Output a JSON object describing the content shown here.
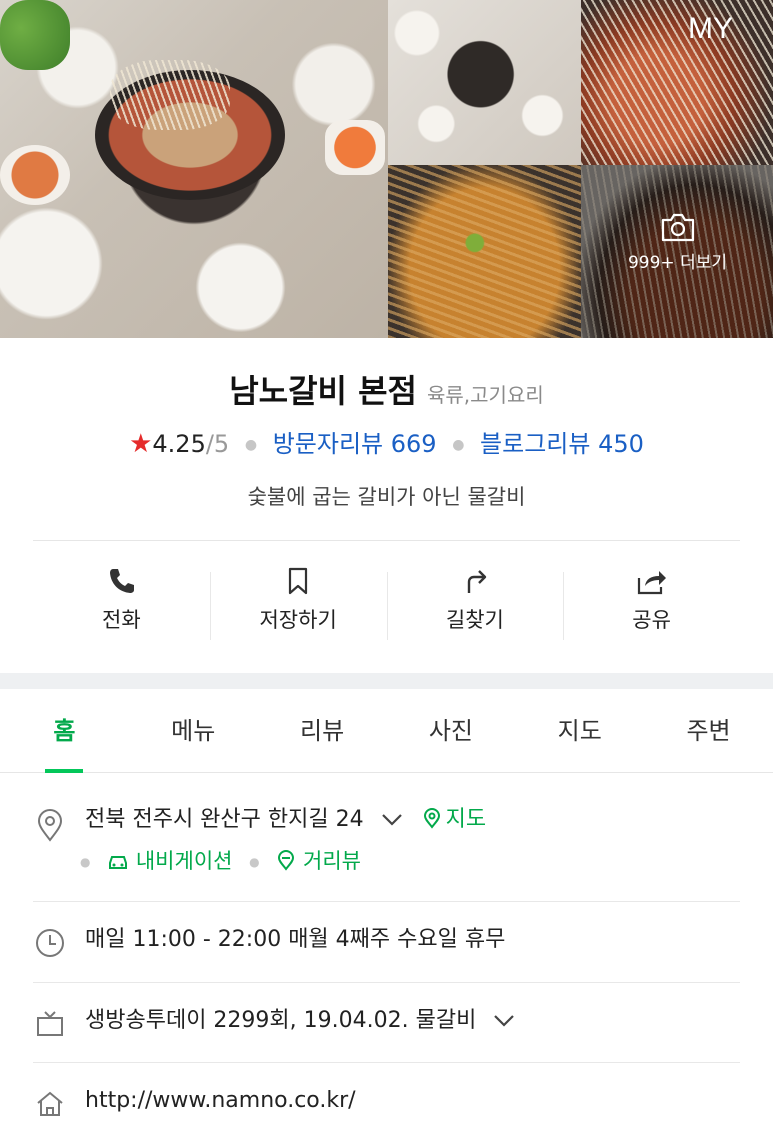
{
  "header": {
    "my_label": "MY"
  },
  "gallery": {
    "more_label": "999+ 더보기"
  },
  "place": {
    "name": "남노갈비 본점",
    "category": "육류,고기요리",
    "rating": "4.25",
    "rating_max": "/5",
    "visitor_reviews": "방문자리뷰 669",
    "blog_reviews": "블로그리뷰 450",
    "description": "숯불에 굽는 갈비가 아닌 물갈비"
  },
  "actions": [
    {
      "label": "전화",
      "icon": "phone-icon"
    },
    {
      "label": "저장하기",
      "icon": "bookmark-icon"
    },
    {
      "label": "길찾기",
      "icon": "directions-icon"
    },
    {
      "label": "공유",
      "icon": "share-icon"
    }
  ],
  "tabs": [
    "홈",
    "메뉴",
    "리뷰",
    "사진",
    "지도",
    "주변"
  ],
  "active_tab": "홈",
  "info": {
    "address": "전북 전주시 완산구 한지길 24",
    "map_link": "지도",
    "navigation_link": "내비게이션",
    "streetview_link": "거리뷰",
    "hours": "매일 11:00 - 22:00 매월 4째주 수요일 휴무",
    "tv": "생방송투데이 2299회, 19.04.02. 물갈비",
    "website": "http://www.namno.co.kr/"
  },
  "colors": {
    "accent_green": "#03c75a",
    "link_blue": "#1a5fc4",
    "star_red": "#e52b2b"
  }
}
